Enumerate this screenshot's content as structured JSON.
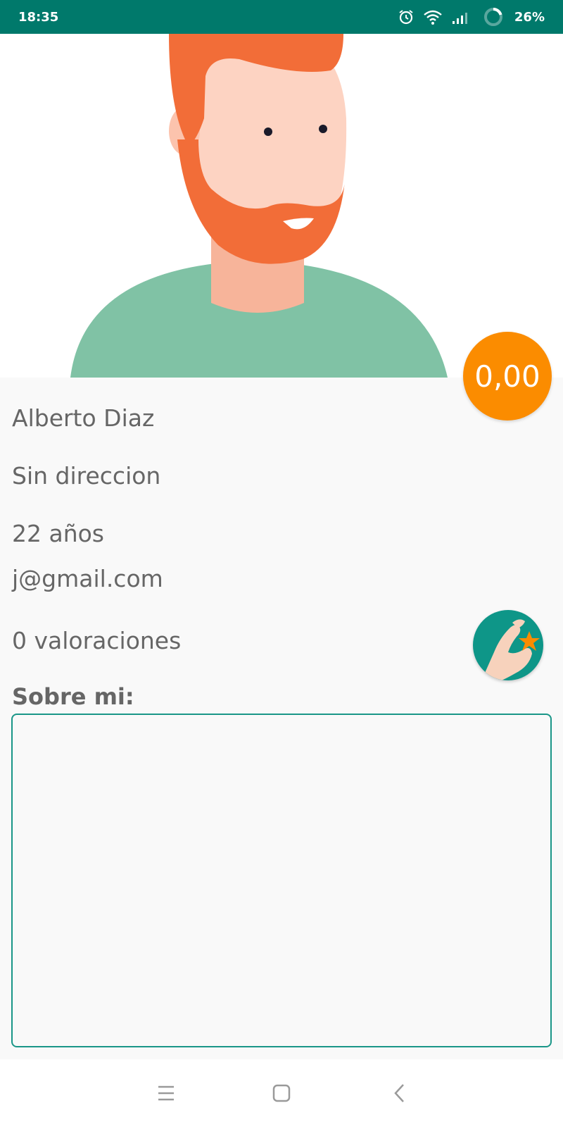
{
  "status_bar": {
    "time": "18:35",
    "battery": "26%",
    "icons": [
      "alarm-icon",
      "wifi-icon",
      "signal-icon",
      "battery-ring-icon"
    ],
    "color": "#00796b"
  },
  "profile": {
    "avatar": "red-bearded-man-avatar",
    "rating_value": "0,00",
    "name": "Alberto Diaz",
    "address": "Sin direccion",
    "age": "22 años",
    "email": "j@gmail.com",
    "ratings_count": "0 valoraciones",
    "rate_button_icon": "hand-holding-star-icon",
    "about_label": "Sobre mi:",
    "about_text": ""
  },
  "nav_bar": {
    "buttons": [
      "menu-icon",
      "home-square-icon",
      "back-chevron-icon"
    ]
  },
  "colors": {
    "accent": "#fb8c00",
    "primary": "#00796b",
    "border": "#1a9688",
    "text": "#666666"
  }
}
